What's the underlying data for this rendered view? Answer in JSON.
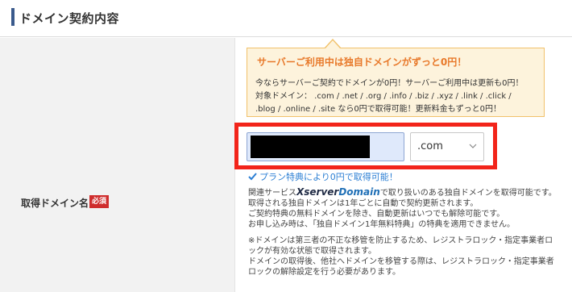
{
  "section": {
    "title": "ドメイン契約内容"
  },
  "field": {
    "label": "取得ドメイン名",
    "required_badge": "必須"
  },
  "promo": {
    "title": "サーバーご利用中は独自ドメインがずっと0円！",
    "lines": [
      "今ならサーバーご契約でドメインが0円！サーバーご利用中は更新も0円！",
      "対象ドメイン： .com / .net / .org / .info / .biz / .xyz / .link / .click /",
      ".blog / .online / .site なら0円で取得可能！更新料金もずっと0円！"
    ]
  },
  "domain_input": {
    "value": ""
  },
  "tld_select": {
    "selected": ".com"
  },
  "perk": {
    "text": "プラン特典により0円で取得可能！"
  },
  "description": {
    "prefix": "関連サービス",
    "brand_x": "Xserver",
    "brand_domain": "Domain",
    "suffix": "で取り扱いのある独自ドメインを取得可能です。",
    "lines": [
      "取得される独自ドメインは1年ごとに自動で契約更新されます。",
      "ご契約特典の無料ドメインを除き、自動更新はいつでも解除可能です。",
      "お申し込み時は、「独自ドメイン1年無料特典」の特典を適用できません。"
    ]
  },
  "notes": {
    "lines": [
      "※ドメインは第三者の不正な移管を防止するため、レジストラロック・指定事業者ロ",
      "ックが有効な状態で取得されます。",
      "ドメインの取得後、他社へドメインを移管する際は、レジストラロック・指定事業者",
      "ロックの解除設定を行う必要があります。"
    ]
  },
  "colors": {
    "accent_bar": "#3a5a8c",
    "highlight_border": "#f2241a",
    "promo_title": "#e8792a",
    "perk_text": "#2c7fd4",
    "required_badge": "#cf2d2d"
  },
  "icons": {
    "select_arrow": "chevron-down-icon",
    "perk_check": "check-icon"
  }
}
